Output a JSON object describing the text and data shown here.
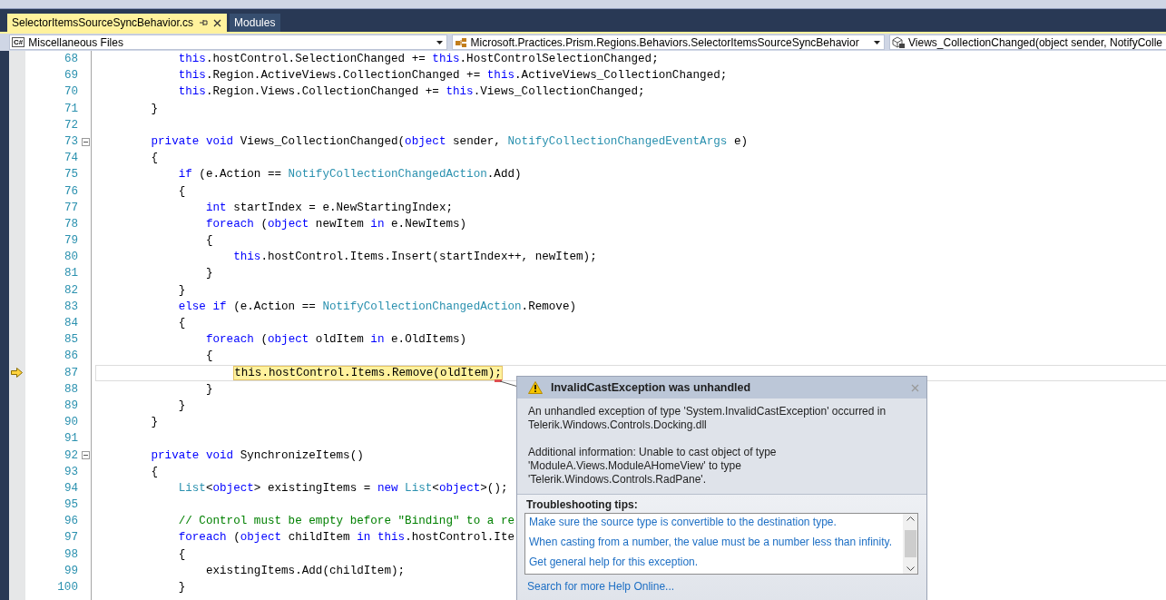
{
  "tabs": [
    {
      "label": "SelectorItemsSourceSyncBehavior.cs",
      "selected": true,
      "pinnable": true
    },
    {
      "label": "Modules",
      "selected": false,
      "pinnable": false
    }
  ],
  "navigation": [
    {
      "kind": "file",
      "badge": "C#",
      "label": "Miscellaneous Files"
    },
    {
      "kind": "class",
      "label": "Microsoft.Practices.Prism.Regions.Behaviors.SelectorItemsSourceSyncBehavior"
    },
    {
      "kind": "method",
      "label": "Views_CollectionChanged(object sender, NotifyColle"
    }
  ],
  "editor": {
    "lines": [
      {
        "number": "68",
        "tokens": [
          {
            "kind": "keyword",
            "text": "            this"
          },
          {
            "kind": "plain",
            "text": ".hostControl.SelectionChanged +="
          },
          {
            "kind": "keyword",
            "text": " this"
          },
          {
            "kind": "plain",
            "text": ".HostControlSelectionChanged;"
          }
        ]
      },
      {
        "number": "69",
        "tokens": [
          {
            "kind": "keyword",
            "text": "            this"
          },
          {
            "kind": "plain",
            "text": ".Region.ActiveViews.CollectionChanged +="
          },
          {
            "kind": "keyword",
            "text": " this"
          },
          {
            "kind": "plain",
            "text": ".ActiveViews_CollectionChanged;"
          }
        ]
      },
      {
        "number": "70",
        "tokens": [
          {
            "kind": "keyword",
            "text": "            this"
          },
          {
            "kind": "plain",
            "text": ".Region.Views.CollectionChanged +="
          },
          {
            "kind": "keyword",
            "text": " this"
          },
          {
            "kind": "plain",
            "text": ".Views_CollectionChanged;"
          }
        ]
      },
      {
        "number": "71",
        "tokens": [
          {
            "kind": "plain",
            "text": "        }"
          }
        ]
      },
      {
        "number": "72"
      },
      {
        "number": "73",
        "expanded": true,
        "tokens": [
          {
            "kind": "keyword",
            "text": "        private void"
          },
          {
            "kind": "plain",
            "text": " Views_CollectionChanged("
          },
          {
            "kind": "keyword",
            "text": "object"
          },
          {
            "kind": "plain",
            "text": " sender,"
          },
          {
            "kind": "type",
            "text": " NotifyCollectionChangedEventArgs"
          },
          {
            "kind": "plain",
            "text": " e)"
          }
        ]
      },
      {
        "number": "74",
        "tokens": [
          {
            "kind": "plain",
            "text": "        {"
          }
        ]
      },
      {
        "number": "75",
        "tokens": [
          {
            "kind": "keyword",
            "text": "            if"
          },
          {
            "kind": "plain",
            "text": " (e.Action =="
          },
          {
            "kind": "type",
            "text": " NotifyCollectionChangedAction"
          },
          {
            "kind": "plain",
            "text": ".Add)"
          }
        ]
      },
      {
        "number": "76",
        "tokens": [
          {
            "kind": "plain",
            "text": "            {"
          }
        ]
      },
      {
        "number": "77",
        "tokens": [
          {
            "kind": "keyword",
            "text": "                int"
          },
          {
            "kind": "plain",
            "text": " startIndex = e.NewStartingIndex;"
          }
        ]
      },
      {
        "number": "78",
        "tokens": [
          {
            "kind": "keyword",
            "text": "                foreach"
          },
          {
            "kind": "plain",
            "text": " ("
          },
          {
            "kind": "keyword",
            "text": "object"
          },
          {
            "kind": "plain",
            "text": " newItem"
          },
          {
            "kind": "keyword",
            "text": " in"
          },
          {
            "kind": "plain",
            "text": " e.NewItems)"
          }
        ]
      },
      {
        "number": "79",
        "tokens": [
          {
            "kind": "plain",
            "text": "                {"
          }
        ]
      },
      {
        "number": "80",
        "tokens": [
          {
            "kind": "keyword",
            "text": "                    this"
          },
          {
            "kind": "plain",
            "text": ".hostControl.Items.Insert(startIndex++, newItem);"
          }
        ]
      },
      {
        "number": "81",
        "tokens": [
          {
            "kind": "plain",
            "text": "                }"
          }
        ]
      },
      {
        "number": "82",
        "tokens": [
          {
            "kind": "plain",
            "text": "            }"
          }
        ]
      },
      {
        "number": "83",
        "tokens": [
          {
            "kind": "keyword",
            "text": "            else if"
          },
          {
            "kind": "plain",
            "text": " (e.Action =="
          },
          {
            "kind": "type",
            "text": " NotifyCollectionChangedAction"
          },
          {
            "kind": "plain",
            "text": ".Remove)"
          }
        ]
      },
      {
        "number": "84",
        "tokens": [
          {
            "kind": "plain",
            "text": "            {"
          }
        ]
      },
      {
        "number": "85",
        "tokens": [
          {
            "kind": "keyword",
            "text": "                foreach"
          },
          {
            "kind": "plain",
            "text": " ("
          },
          {
            "kind": "keyword",
            "text": "object"
          },
          {
            "kind": "plain",
            "text": " oldItem"
          },
          {
            "kind": "keyword",
            "text": " in"
          },
          {
            "kind": "plain",
            "text": " e.OldItems)"
          }
        ]
      },
      {
        "number": "86",
        "tokens": [
          {
            "kind": "plain",
            "text": "                {"
          }
        ]
      },
      {
        "number": "87",
        "current": true,
        "tokens": [
          {
            "kind": "highlight",
            "text": "                    this.hostControl.Items.Remove(oldItem);"
          }
        ]
      },
      {
        "number": "88",
        "tokens": [
          {
            "kind": "plain",
            "text": "                }"
          }
        ]
      },
      {
        "number": "89",
        "tokens": [
          {
            "kind": "plain",
            "text": "            }"
          }
        ]
      },
      {
        "number": "90",
        "tokens": [
          {
            "kind": "plain",
            "text": "        }"
          }
        ]
      },
      {
        "number": "91"
      },
      {
        "number": "92",
        "expanded": true,
        "tokens": [
          {
            "kind": "keyword",
            "text": "        private void"
          },
          {
            "kind": "plain",
            "text": " SynchronizeItems()"
          }
        ]
      },
      {
        "number": "93",
        "tokens": [
          {
            "kind": "plain",
            "text": "        {"
          }
        ]
      },
      {
        "number": "94",
        "tokens": [
          {
            "kind": "type",
            "text": "            List"
          },
          {
            "kind": "plain",
            "text": "<"
          },
          {
            "kind": "keyword",
            "text": "object"
          },
          {
            "kind": "plain",
            "text": "> existingItems ="
          },
          {
            "kind": "keyword",
            "text": " new"
          },
          {
            "kind": "type",
            "text": " List"
          },
          {
            "kind": "plain",
            "text": "<"
          },
          {
            "kind": "keyword",
            "text": "object"
          },
          {
            "kind": "plain",
            "text": ">();"
          }
        ]
      },
      {
        "number": "95"
      },
      {
        "number": "96",
        "tokens": [
          {
            "kind": "comment",
            "text": "            // Control must be empty before \"Binding\" to a re"
          }
        ]
      },
      {
        "number": "97",
        "tokens": [
          {
            "kind": "keyword",
            "text": "            foreach"
          },
          {
            "kind": "plain",
            "text": " ("
          },
          {
            "kind": "keyword",
            "text": "object"
          },
          {
            "kind": "plain",
            "text": " childItem"
          },
          {
            "kind": "keyword",
            "text": " in this"
          },
          {
            "kind": "plain",
            "text": ".hostControl.Ite"
          }
        ]
      },
      {
        "number": "98",
        "tokens": [
          {
            "kind": "plain",
            "text": "            {"
          }
        ]
      },
      {
        "number": "99",
        "tokens": [
          {
            "kind": "plain",
            "text": "                existingItems.Add(childItem);"
          }
        ]
      },
      {
        "number": "100",
        "tokens": [
          {
            "kind": "plain",
            "text": "            }"
          }
        ]
      }
    ]
  },
  "exception_popup": {
    "title": "InvalidCastException was unhandled",
    "message": "An unhandled exception of type 'System.InvalidCastException' occurred in Telerik.Windows.Controls.Docking.dll",
    "additional_information": "Additional information: Unable to cast object of type 'ModuleA.Views.ModuleAHomeView' to type 'Telerik.Windows.Controls.RadPane'.",
    "tips_heading": "Troubleshooting tips:",
    "tips": [
      "Make sure the source type is convertible to the destination type.",
      "When casting from a number, the value must be a number less than infinity.",
      "Get general help for this exception."
    ],
    "help_link": "Search for more Help Online..."
  }
}
